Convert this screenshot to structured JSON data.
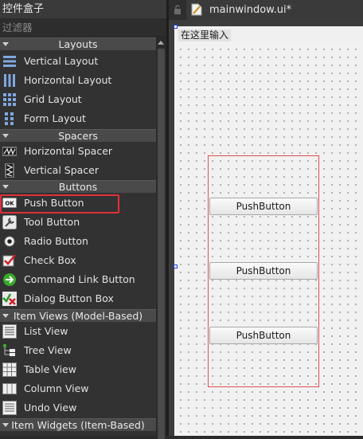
{
  "widget_box": {
    "title": "控件盒子",
    "filter_placeholder": "过滤器",
    "categories": {
      "layouts": "Layouts",
      "spacers": "Spacers",
      "buttons": "Buttons",
      "item_views": "Item Views (Model-Based)",
      "item_widgets": "Item Widgets (Item-Based)"
    },
    "items": {
      "vertical_layout": "Vertical Layout",
      "horizontal_layout": "Horizontal Layout",
      "grid_layout": "Grid Layout",
      "form_layout": "Form Layout",
      "horizontal_spacer": "Horizontal Spacer",
      "vertical_spacer": "Vertical Spacer",
      "push_button": "Push Button",
      "tool_button": "Tool Button",
      "radio_button": "Radio Button",
      "check_box": "Check Box",
      "command_link_button": "Command Link Button",
      "dialog_button_box": "Dialog Button Box",
      "list_view": "List View",
      "tree_view": "Tree View",
      "table_view": "Table View",
      "column_view": "Column View",
      "undo_view": "Undo View"
    },
    "push_button_icon_text": "OK",
    "selected_item": "Push Button",
    "highlight_color": "#e0303a"
  },
  "editor": {
    "tab_title": "mainwindow.ui*",
    "menu_placeholder": "在这里输入",
    "buttons": [
      "PushButton",
      "PushButton",
      "PushButton"
    ],
    "layout_border_color": "#e05050",
    "handle_color": "#1a3fd8"
  }
}
